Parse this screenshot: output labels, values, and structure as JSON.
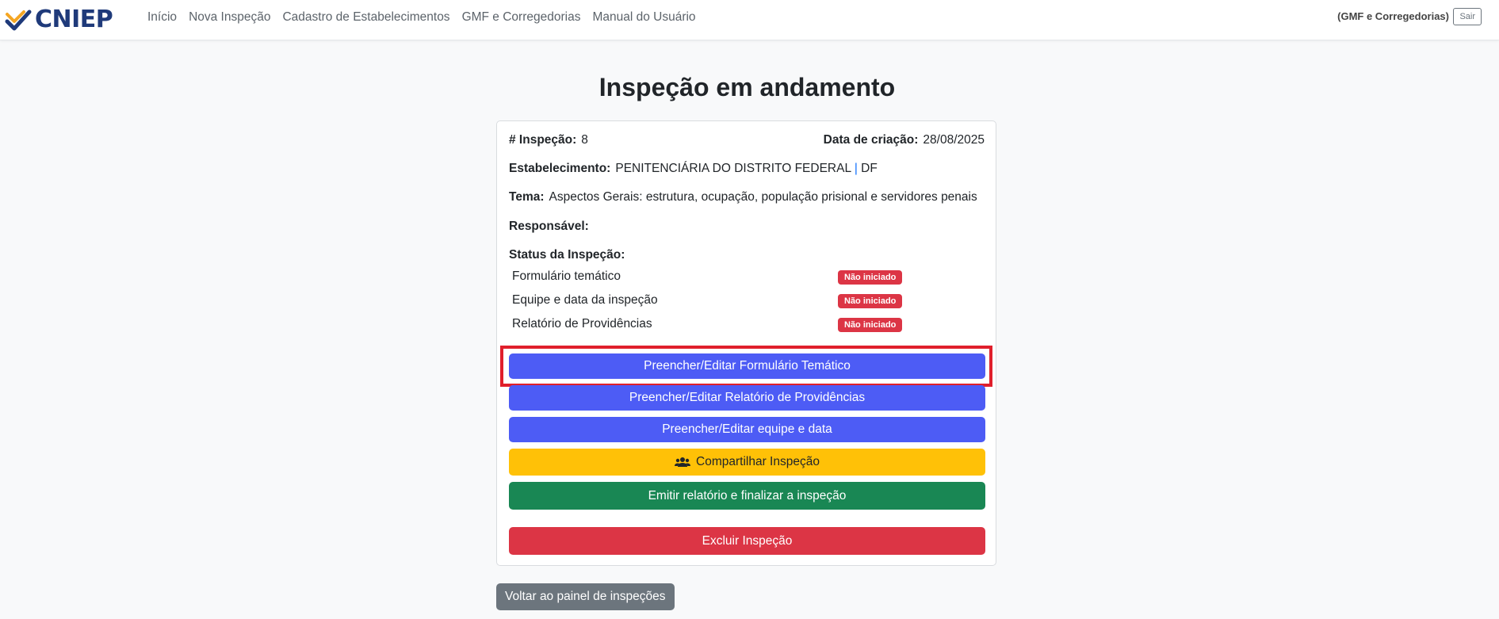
{
  "brand": {
    "name": "CNIEP",
    "icon": "check-logo-icon"
  },
  "nav": {
    "links": [
      "Início",
      "Nova Inspeção",
      "Cadastro de Estabelecimentos",
      "GMF e Corregedorias",
      "Manual do Usuário"
    ],
    "user_label": "(GMF e Corregedorias)",
    "logout": "Sair"
  },
  "page": {
    "title": "Inspeção em andamento"
  },
  "inspection": {
    "id_label": "# Inspeção:",
    "id_value": "8",
    "created_label": "Data de criação:",
    "created_value": "28/08/2025",
    "establishment_label": "Estabelecimento:",
    "establishment_value": "PENITENCIÁRIA DO DISTRITO FEDERAL",
    "establishment_sep": "|",
    "establishment_uf": "DF",
    "theme_label": "Tema:",
    "theme_value": "Aspectos Gerais: estrutura, ocupação, população prisional e servidores penais",
    "responsible_label": "Responsável:",
    "status_label": "Status da Inspeção:",
    "status_items": [
      {
        "label": "Formulário temático",
        "badge": "Não iniciado"
      },
      {
        "label": "Equipe e data da inspeção",
        "badge": "Não iniciado"
      },
      {
        "label": "Relatório de Providências",
        "badge": "Não iniciado"
      }
    ]
  },
  "actions": {
    "edit_form": "Preencher/Editar Formulário Temático",
    "edit_report": "Preencher/Editar Relatório de Providências",
    "edit_team": "Preencher/Editar equipe e data",
    "share": "Compartilhar Inspeção",
    "share_icon": "users-icon",
    "finalize": "Emitir relatório e finalizar a inspeção",
    "delete": "Excluir Inspeção",
    "back": "Voltar ao painel de inspeções"
  },
  "colors": {
    "primary": "#4d5cf5",
    "warning": "#ffc107",
    "success": "#198754",
    "danger": "#dc3545",
    "highlight": "#e01f2b",
    "brand": "#1f3a7a"
  }
}
